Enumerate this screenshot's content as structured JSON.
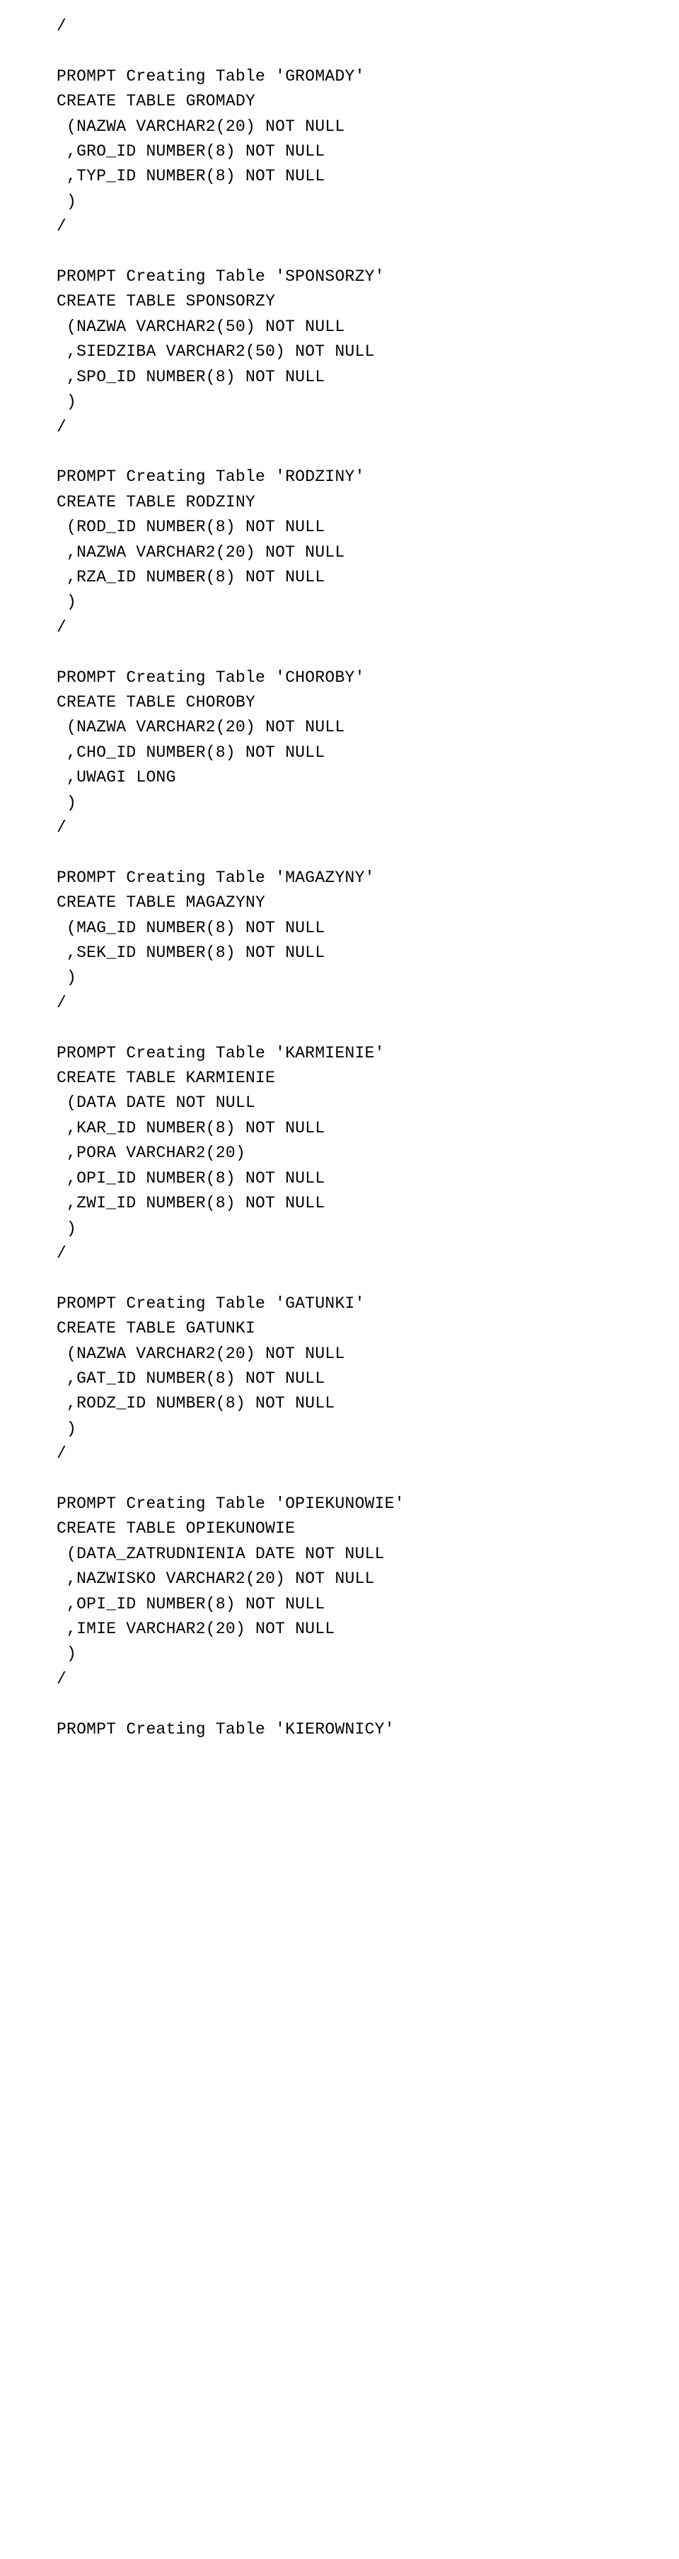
{
  "code_text": "/\n\nPROMPT Creating Table 'GROMADY'\nCREATE TABLE GROMADY\n (NAZWA VARCHAR2(20) NOT NULL\n ,GRO_ID NUMBER(8) NOT NULL\n ,TYP_ID NUMBER(8) NOT NULL\n )\n/\n\nPROMPT Creating Table 'SPONSORZY'\nCREATE TABLE SPONSORZY\n (NAZWA VARCHAR2(50) NOT NULL\n ,SIEDZIBA VARCHAR2(50) NOT NULL\n ,SPO_ID NUMBER(8) NOT NULL\n )\n/\n\nPROMPT Creating Table 'RODZINY'\nCREATE TABLE RODZINY\n (ROD_ID NUMBER(8) NOT NULL\n ,NAZWA VARCHAR2(20) NOT NULL\n ,RZA_ID NUMBER(8) NOT NULL\n )\n/\n\nPROMPT Creating Table 'CHOROBY'\nCREATE TABLE CHOROBY\n (NAZWA VARCHAR2(20) NOT NULL\n ,CHO_ID NUMBER(8) NOT NULL\n ,UWAGI LONG\n )\n/\n\nPROMPT Creating Table 'MAGAZYNY'\nCREATE TABLE MAGAZYNY\n (MAG_ID NUMBER(8) NOT NULL\n ,SEK_ID NUMBER(8) NOT NULL\n )\n/\n\nPROMPT Creating Table 'KARMIENIE'\nCREATE TABLE KARMIENIE\n (DATA DATE NOT NULL\n ,KAR_ID NUMBER(8) NOT NULL\n ,PORA VARCHAR2(20)\n ,OPI_ID NUMBER(8) NOT NULL\n ,ZWI_ID NUMBER(8) NOT NULL\n )\n/\n\nPROMPT Creating Table 'GATUNKI'\nCREATE TABLE GATUNKI\n (NAZWA VARCHAR2(20) NOT NULL\n ,GAT_ID NUMBER(8) NOT NULL\n ,RODZ_ID NUMBER(8) NOT NULL\n )\n/\n\nPROMPT Creating Table 'OPIEKUNOWIE'\nCREATE TABLE OPIEKUNOWIE\n (DATA_ZATRUDNIENIA DATE NOT NULL\n ,NAZWISKO VARCHAR2(20) NOT NULL\n ,OPI_ID NUMBER(8) NOT NULL\n ,IMIE VARCHAR2(20) NOT NULL\n )\n/\n\nPROMPT Creating Table 'KIEROWNICY'"
}
